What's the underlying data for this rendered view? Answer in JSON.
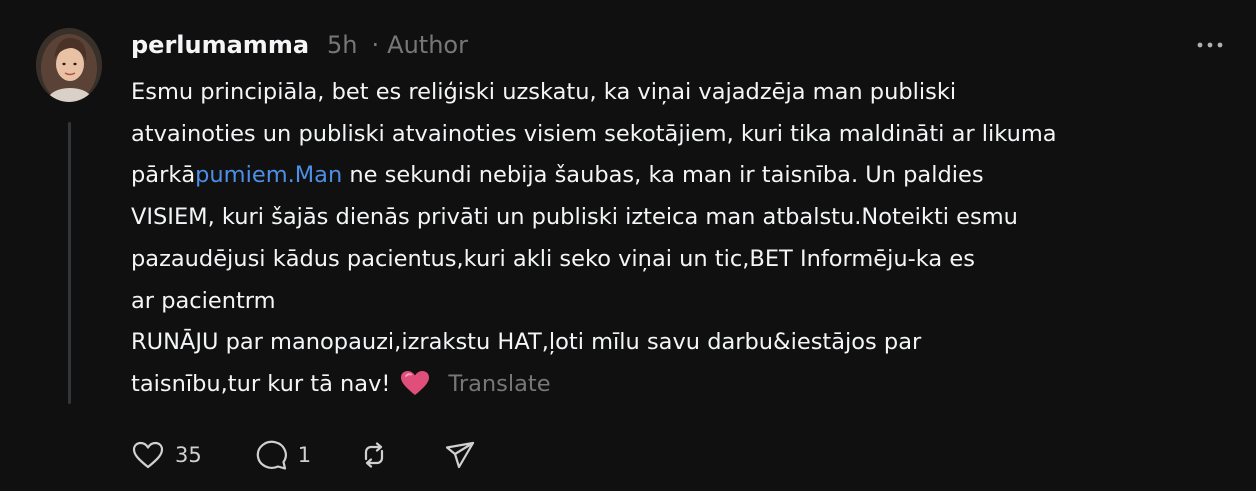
{
  "post": {
    "username": "perlumamma",
    "time": "5h",
    "separator": "·",
    "author_badge": "Author",
    "body_lines": {
      "l1": "Esmu principiāla, bet es reliģiski uzskatu, ka viņai vajadzēja man publiski",
      "l2": "atvainoties un publiski atvainoties visiem sekotājiem, kuri tika maldināti ar likuma",
      "l3_pre": "pārkā",
      "l3_link": "pumiem.Man",
      "l3_post": " ne sekundi nebija šaubas, ka man ir taisnība. Un paldies",
      "l4": "VISIEM, kuri šajās dienās privāti un publiski izteica man atbalstu.Noteikti esmu",
      "l5": "pazaudējusi kādus pacientus,kuri akli seko viņai un tic,BET Informēju-ka es",
      "l6": "ar pacientrm",
      "l7": "RUNĀJU par manopauzi,izrakstu HAT,ļoti mīlu savu darbu&iestājos par",
      "l8": "taisnību,tur kur tā nav!"
    },
    "translate_label": "Translate",
    "link_color": "#4d8ee6",
    "emoji": "pink-heart-icon"
  },
  "actions": {
    "like_count": "35",
    "reply_count": "1",
    "icons": [
      "heart-icon",
      "comment-icon",
      "repost-icon",
      "share-icon"
    ]
  },
  "menu": {
    "icon": "more-options-icon"
  }
}
